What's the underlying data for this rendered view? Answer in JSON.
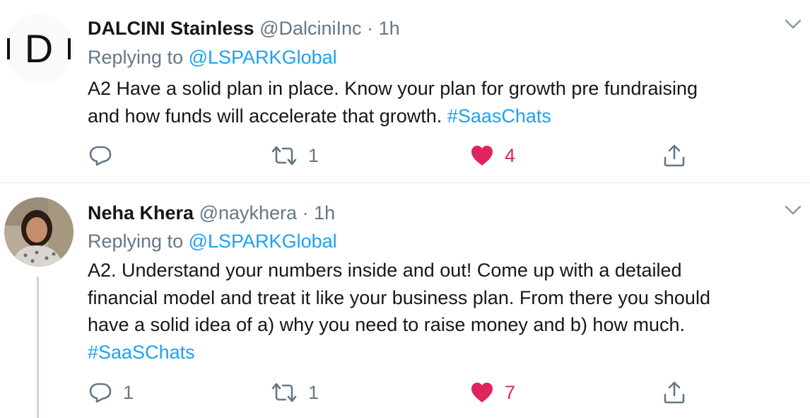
{
  "tweets": [
    {
      "display_name": "DALCINI Stainless",
      "handle": "@DalciniInc",
      "separator": "·",
      "time": "1h",
      "replying_prefix": "Replying to",
      "replying_to": "@LSPARKGlobal",
      "text_line1": "A2 Have a solid plan in place. Know your plan for growth pre fundraising",
      "text_line2": "and how funds will accelerate that growth.",
      "hashtag": "#SaasChats",
      "reply_count": "",
      "retweet_count": "1",
      "like_count": "4",
      "avatar_letter": "D"
    },
    {
      "display_name": "Neha Khera",
      "handle": "@naykhera",
      "separator": "·",
      "time": "1h",
      "replying_prefix": "Replying to",
      "replying_to": "@LSPARKGlobal",
      "text_line1": "A2. Understand your numbers inside and out! Come up with a detailed",
      "text_line2": "financial model and treat it like your business plan. From there you should",
      "text_line3": "have a solid idea of a) why you need to raise money and b) how much.",
      "hashtag": "#SaaSChats",
      "reply_count": "1",
      "retweet_count": "1",
      "like_count": "7"
    }
  ],
  "icons": {
    "reply": "reply-icon",
    "retweet": "retweet-icon",
    "like": "heart-icon",
    "share": "share-icon",
    "more": "chevron-down-icon"
  },
  "colors": {
    "link": "#1da1f2",
    "like": "#e0245e",
    "muted": "#657786",
    "text": "#14171a"
  }
}
